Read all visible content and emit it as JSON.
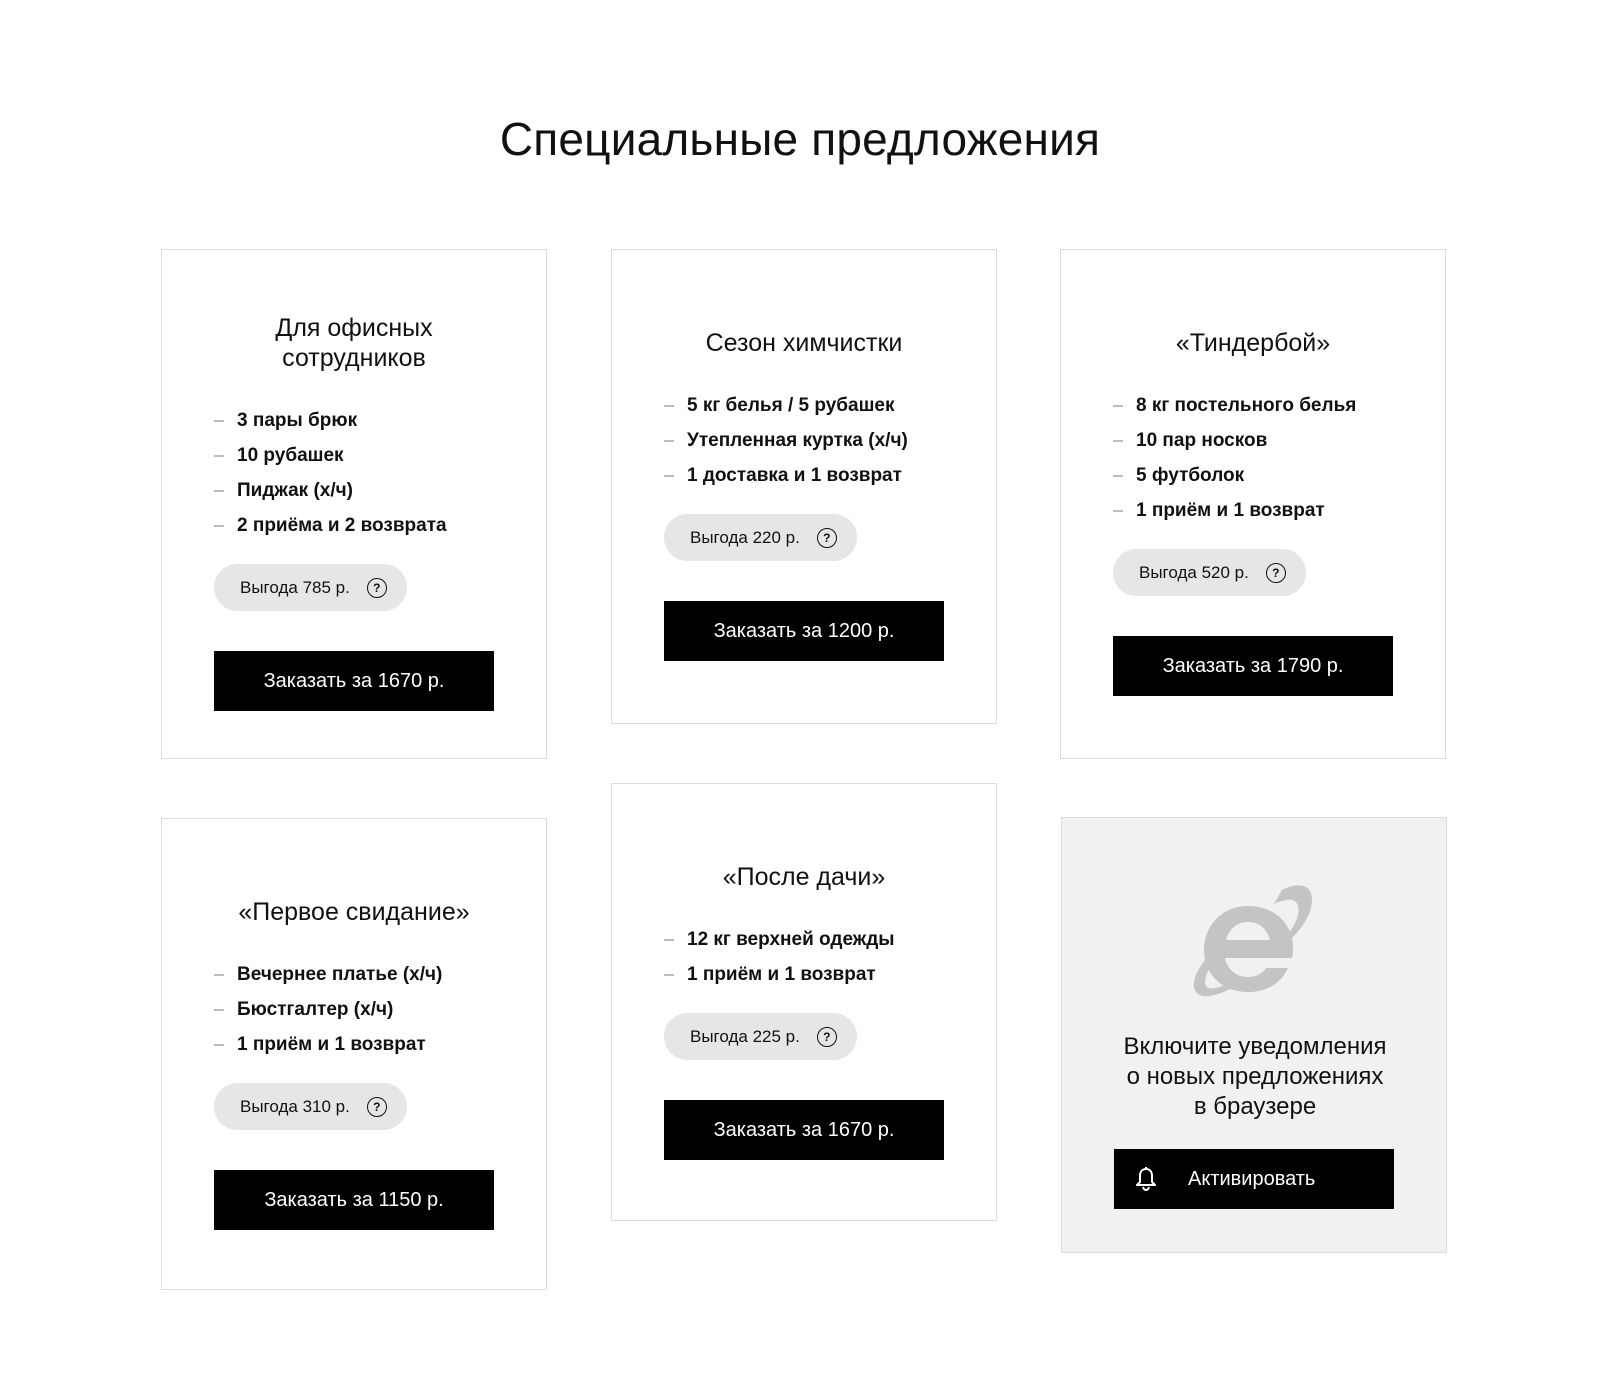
{
  "page": {
    "title": "Специальные предложения"
  },
  "offers": [
    {
      "title_line1": "Для офисных",
      "title_line2": "сотрудников",
      "items": [
        "3 пары брюк",
        "10 рубашек",
        "Пиджак (х/ч)",
        "2 приёма и 2 возврата"
      ],
      "savings": "Выгода 785 р.",
      "button": "Заказать за 1670 р."
    },
    {
      "title_line1": "Сезон химчистки",
      "title_line2": "",
      "items": [
        "5 кг белья / 5 рубашек",
        "Утепленная куртка (х/ч)",
        "1 доставка и 1 возврат"
      ],
      "savings": "Выгода 220 р.",
      "button": "Заказать за 1200 р."
    },
    {
      "title_line1": "«Тиндербой»",
      "title_line2": "",
      "items": [
        "8 кг постельного белья",
        "10 пар носков",
        "5 футболок",
        "1 приём и 1 возврат"
      ],
      "savings": "Выгода 520 р.",
      "button": "Заказать за 1790 р."
    },
    {
      "title_line1": "«Первое свидание»",
      "title_line2": "",
      "items": [
        "Вечернее платье (х/ч)",
        "Бюстгалтер (х/ч)",
        "1 приём и 1 возврат"
      ],
      "savings": "Выгода 310 р.",
      "button": "Заказать за 1150 р."
    },
    {
      "title_line1": "«После дачи»",
      "title_line2": "",
      "items": [
        "12 кг верхней одежды",
        "1 приём и 1 возврат"
      ],
      "savings": "Выгода 225 р.",
      "button": "Заказать за 1670 р."
    }
  ],
  "notifications": {
    "text_line1": "Включите уведомления",
    "text_line2": "о новых предложениях",
    "text_line3": "в браузере",
    "button": "Активировать",
    "icon": "internet-explorer-icon",
    "button_icon": "bell-icon"
  },
  "help_icon_glyph": "?",
  "colors": {
    "button_bg": "#000000",
    "savings_bg": "#e6e6e6",
    "notify_bg": "#f1f1f1",
    "ie_icon": "#c4c4c4"
  }
}
